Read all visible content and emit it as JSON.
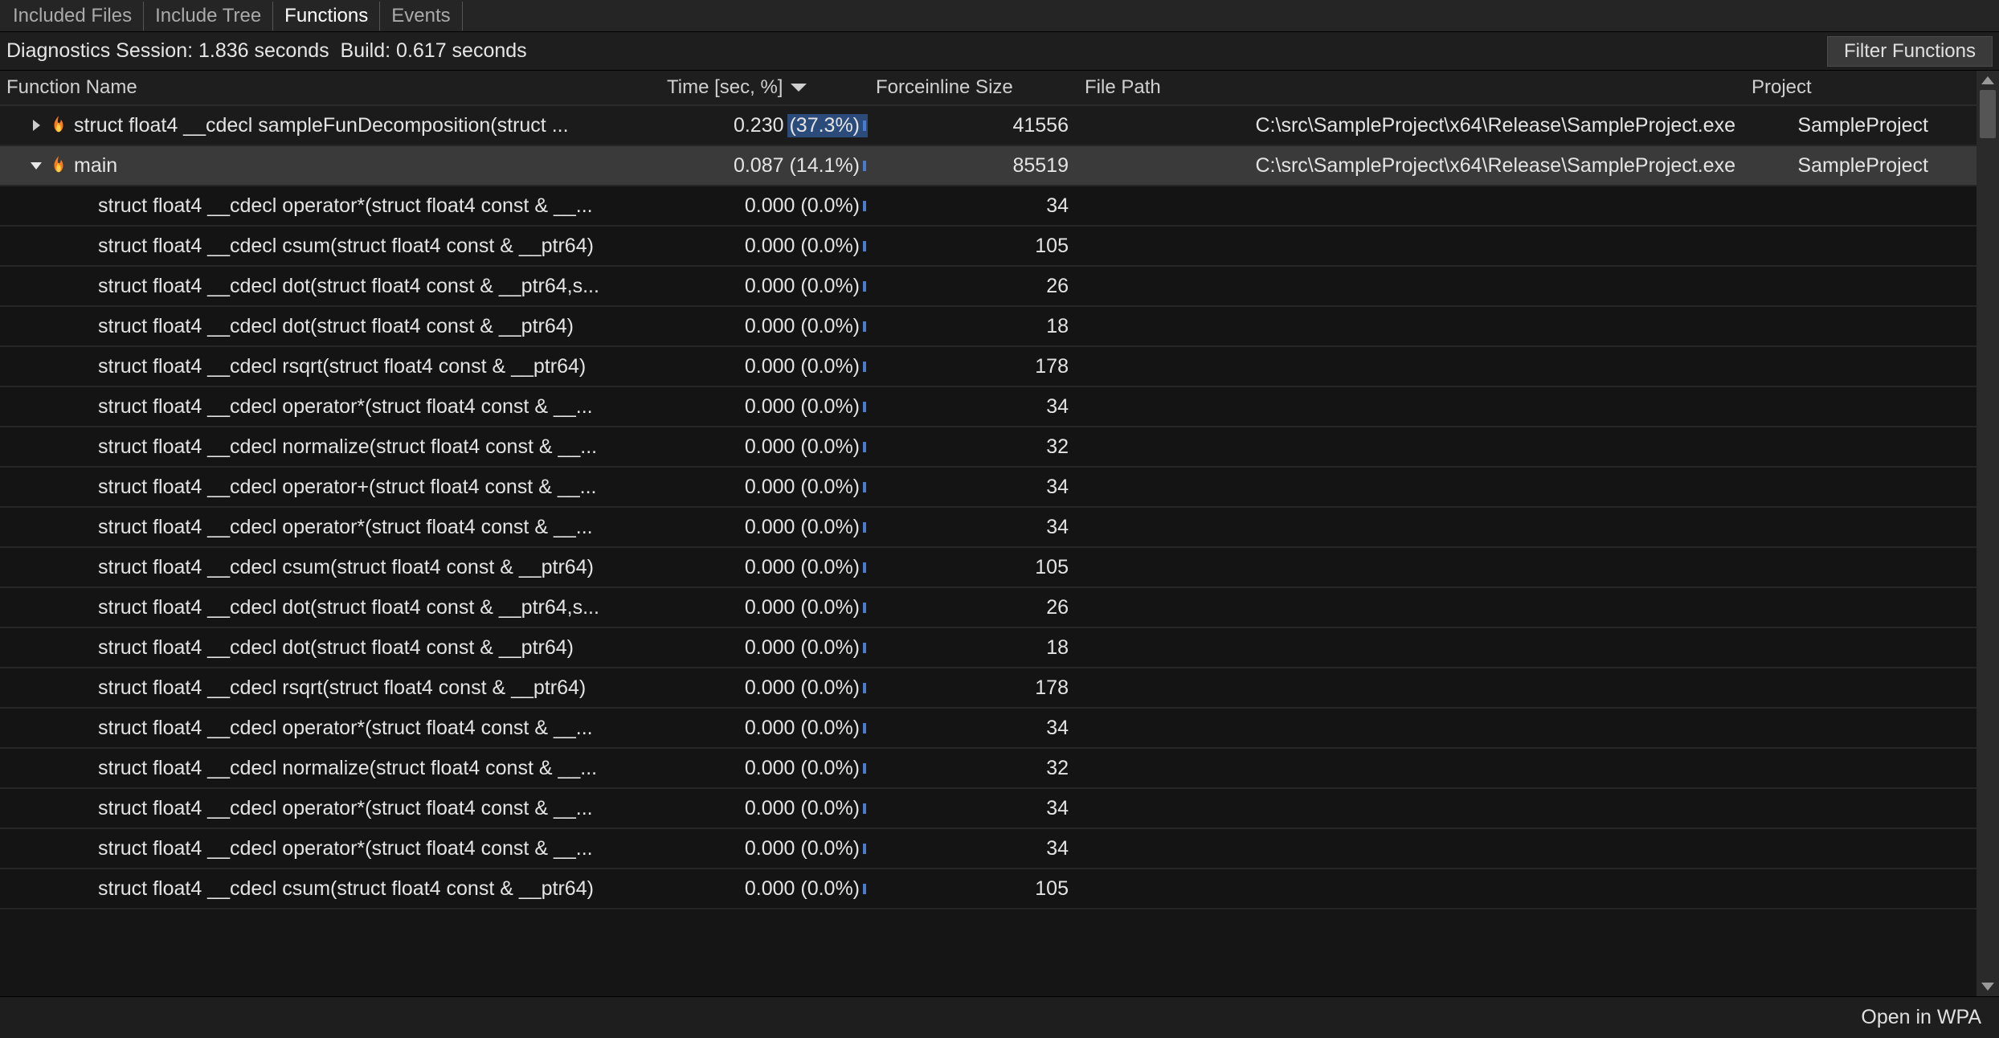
{
  "tabs": [
    "Included Files",
    "Include Tree",
    "Functions",
    "Events"
  ],
  "active_tab_index": 2,
  "diagnostics": {
    "session_label": "Diagnostics Session:",
    "session_value": "1.836 seconds",
    "build_label": "Build:",
    "build_value": "0.617 seconds"
  },
  "filter_button": "Filter Functions",
  "columns": {
    "function": "Function Name",
    "time": "Time [sec, %]",
    "forceinline": "Forceinline Size",
    "filepath": "File Path",
    "project": "Project"
  },
  "rows": [
    {
      "level": 0,
      "expander": "closed",
      "flame": true,
      "fn": "struct float4 __cdecl sampleFunDecomposition(struct ...",
      "time": "0.230 (37.3%)",
      "time_sel": true,
      "fis": "41556",
      "path": "C:\\src\\SampleProject\\x64\\Release\\SampleProject.exe",
      "proj": "SampleProject",
      "top": true
    },
    {
      "level": 0,
      "expander": "open",
      "flame": true,
      "fn": "main",
      "time": "0.087 (14.1%)",
      "fis": "85519",
      "path": "C:\\src\\SampleProject\\x64\\Release\\SampleProject.exe",
      "proj": "SampleProject",
      "selected": true
    },
    {
      "level": 1,
      "fn": "struct float4 __cdecl operator*(struct float4 const & __...",
      "time": "0.000 (0.0%)",
      "fis": "34"
    },
    {
      "level": 1,
      "fn": "struct float4 __cdecl csum(struct float4 const & __ptr64)",
      "time": "0.000 (0.0%)",
      "fis": "105"
    },
    {
      "level": 1,
      "fn": "struct float4 __cdecl dot(struct float4 const & __ptr64,s...",
      "time": "0.000 (0.0%)",
      "fis": "26"
    },
    {
      "level": 1,
      "fn": "struct float4 __cdecl dot(struct float4 const & __ptr64)",
      "time": "0.000 (0.0%)",
      "fis": "18"
    },
    {
      "level": 1,
      "fn": "struct float4 __cdecl rsqrt(struct float4 const & __ptr64)",
      "time": "0.000 (0.0%)",
      "fis": "178"
    },
    {
      "level": 1,
      "fn": "struct float4 __cdecl operator*(struct float4 const & __...",
      "time": "0.000 (0.0%)",
      "fis": "34"
    },
    {
      "level": 1,
      "fn": "struct float4 __cdecl normalize(struct float4 const & __...",
      "time": "0.000 (0.0%)",
      "fis": "32"
    },
    {
      "level": 1,
      "fn": "struct float4 __cdecl operator+(struct float4 const & __...",
      "time": "0.000 (0.0%)",
      "fis": "34"
    },
    {
      "level": 1,
      "fn": "struct float4 __cdecl operator*(struct float4 const & __...",
      "time": "0.000 (0.0%)",
      "fis": "34"
    },
    {
      "level": 1,
      "fn": "struct float4 __cdecl csum(struct float4 const & __ptr64)",
      "time": "0.000 (0.0%)",
      "fis": "105"
    },
    {
      "level": 1,
      "fn": "struct float4 __cdecl dot(struct float4 const & __ptr64,s...",
      "time": "0.000 (0.0%)",
      "fis": "26"
    },
    {
      "level": 1,
      "fn": "struct float4 __cdecl dot(struct float4 const & __ptr64)",
      "time": "0.000 (0.0%)",
      "fis": "18"
    },
    {
      "level": 1,
      "fn": "struct float4 __cdecl rsqrt(struct float4 const & __ptr64)",
      "time": "0.000 (0.0%)",
      "fis": "178"
    },
    {
      "level": 1,
      "fn": "struct float4 __cdecl operator*(struct float4 const & __...",
      "time": "0.000 (0.0%)",
      "fis": "34"
    },
    {
      "level": 1,
      "fn": "struct float4 __cdecl normalize(struct float4 const & __...",
      "time": "0.000 (0.0%)",
      "fis": "32"
    },
    {
      "level": 1,
      "fn": "struct float4 __cdecl operator*(struct float4 const & __...",
      "time": "0.000 (0.0%)",
      "fis": "34"
    },
    {
      "level": 1,
      "fn": "struct float4 __cdecl operator*(struct float4 const & __...",
      "time": "0.000 (0.0%)",
      "fis": "34"
    },
    {
      "level": 1,
      "fn": "struct float4 __cdecl csum(struct float4 const & __ptr64)",
      "time": "0.000 (0.0%)",
      "fis": "105"
    }
  ],
  "footer_link": "Open in WPA"
}
